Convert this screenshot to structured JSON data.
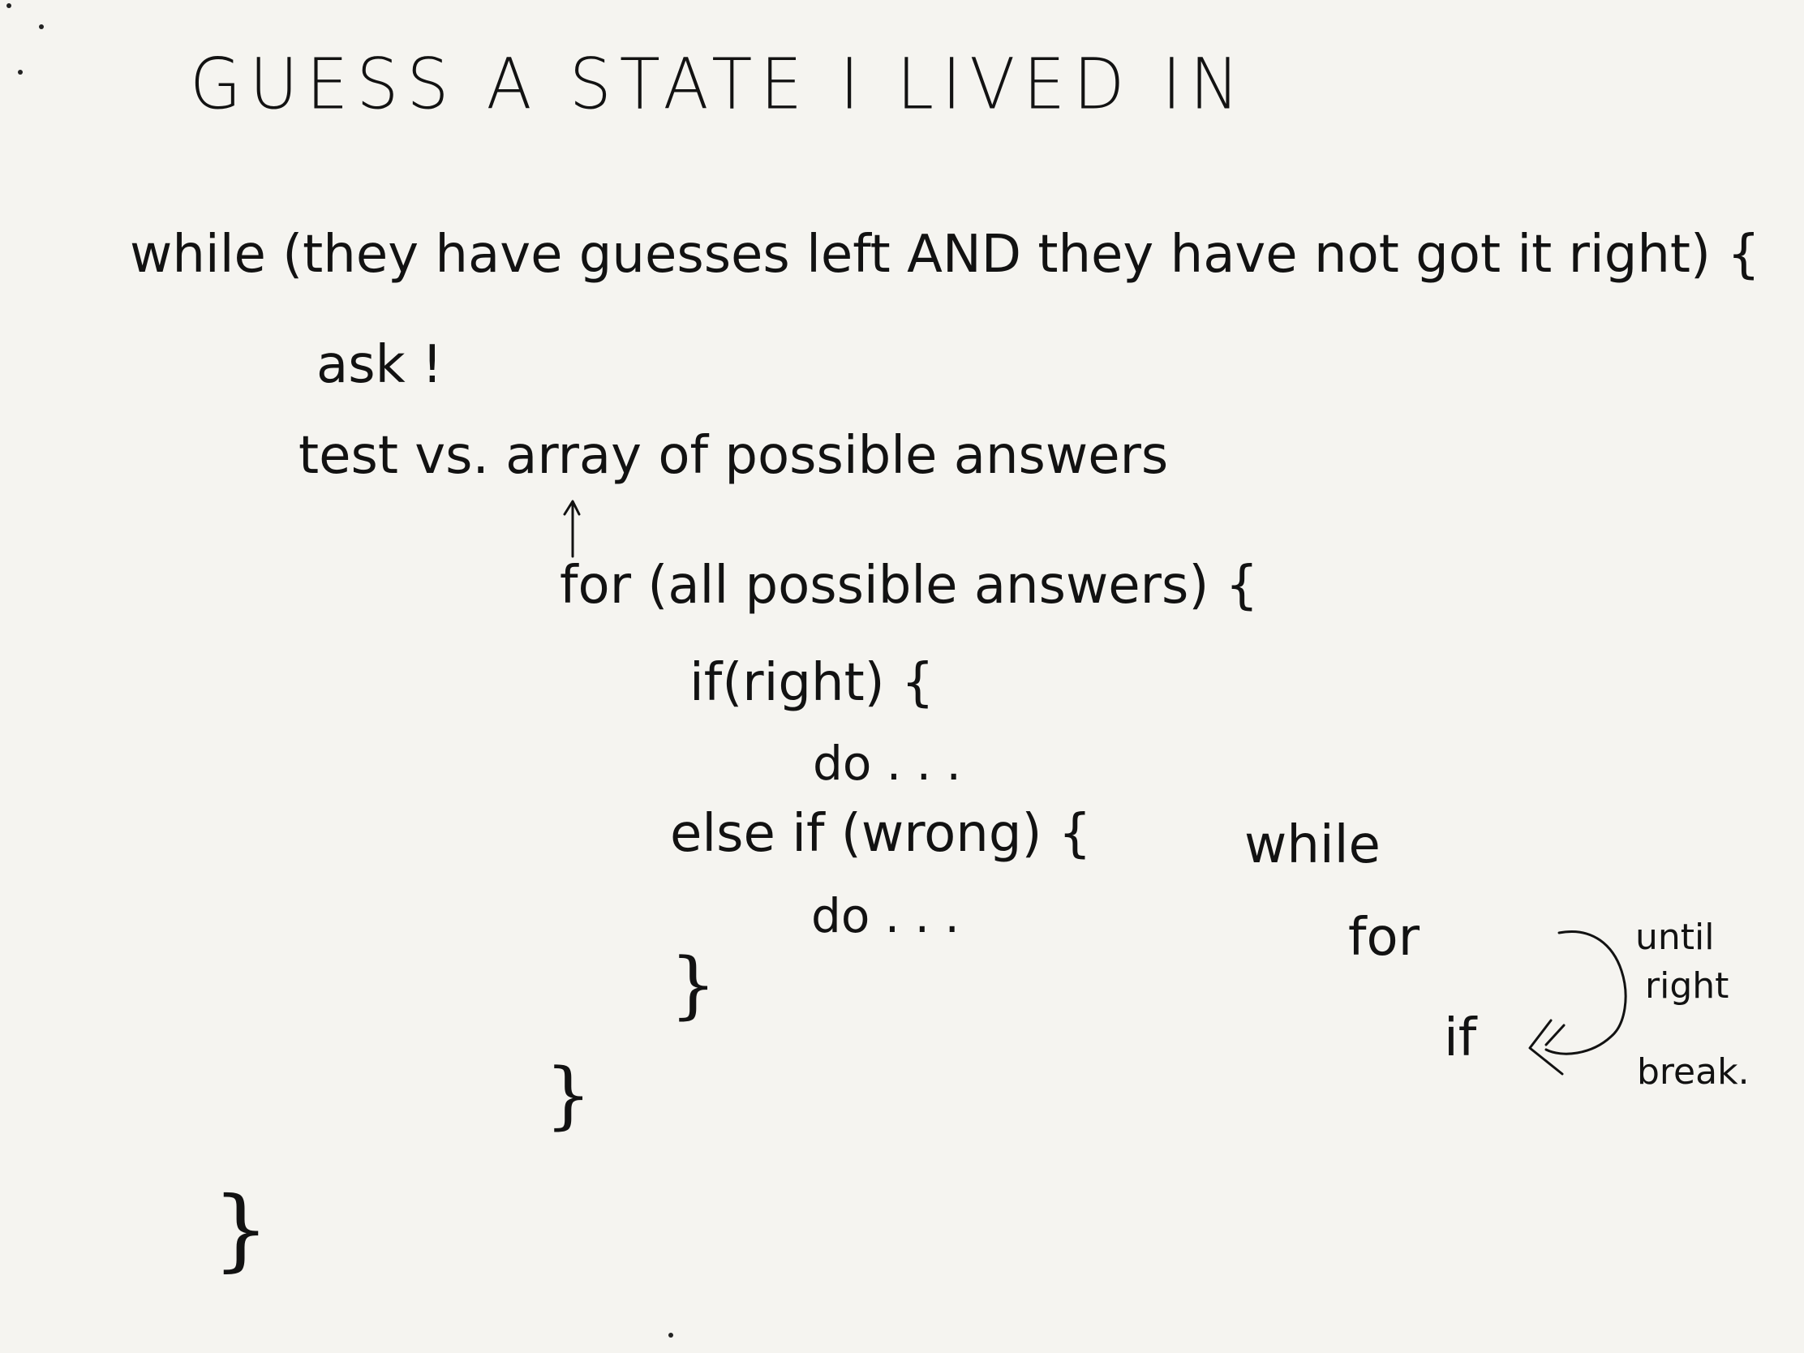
{
  "title": "GUESS A STATE I LIVED IN",
  "lines": {
    "while_line": "while (they have guesses left AND they have not got it right) {",
    "ask": "ask !",
    "test": "test vs. array of possible answers",
    "for_line": "for (all possible answers) {",
    "if_line": "if(right) {",
    "do_1": "do . . .",
    "else_if": "else if (wrong) {",
    "do_2": "do . . .",
    "close_inner": "}",
    "close_for": "}",
    "close_while": "}"
  },
  "side_note": {
    "while": "while",
    "for": "for",
    "if": "if",
    "until": "until",
    "right": "right",
    "break": "break."
  }
}
